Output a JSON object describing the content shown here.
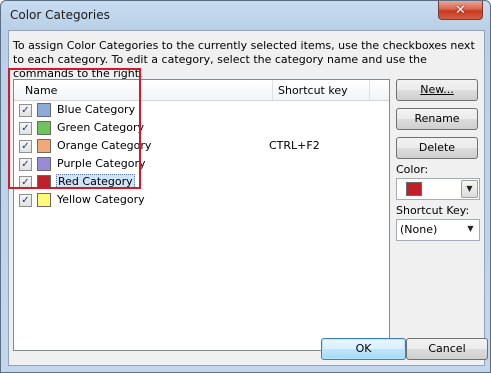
{
  "window": {
    "title": "Color Categories",
    "close_glyph": "✕"
  },
  "instructions": "To assign Color Categories to the currently selected items, use the checkboxes next to each category.  To edit a category, select the category name and use the commands to the right.",
  "list": {
    "columns": {
      "name": "Name",
      "shortcut": "Shortcut key"
    },
    "items": [
      {
        "label": "Blue Category",
        "checked": true,
        "color": "#8eaadb",
        "shortcut": "",
        "selected": false
      },
      {
        "label": "Green Category",
        "checked": true,
        "color": "#6ec35a",
        "shortcut": "",
        "selected": false
      },
      {
        "label": "Orange Category",
        "checked": true,
        "color": "#f4a77a",
        "shortcut": "CTRL+F2",
        "selected": false
      },
      {
        "label": "Purple Category",
        "checked": true,
        "color": "#9b8ad6",
        "shortcut": "",
        "selected": false
      },
      {
        "label": "Red Category",
        "checked": true,
        "color": "#c0202a",
        "shortcut": "",
        "selected": true
      },
      {
        "label": "Yellow Category",
        "checked": true,
        "color": "#fffa7a",
        "shortcut": "",
        "selected": false
      }
    ],
    "highlight_color": "#d11a2a"
  },
  "buttons": {
    "new_label": "New...",
    "rename_label": "Rename",
    "delete_label": "Delete",
    "ok_label": "OK",
    "cancel_label": "Cancel"
  },
  "color_field": {
    "label": "Color:",
    "value_color": "#c0202a"
  },
  "shortcut_field": {
    "label": "Shortcut Key:",
    "value": "(None)"
  },
  "check_glyph": "✓",
  "dropdown_glyph": "▼"
}
